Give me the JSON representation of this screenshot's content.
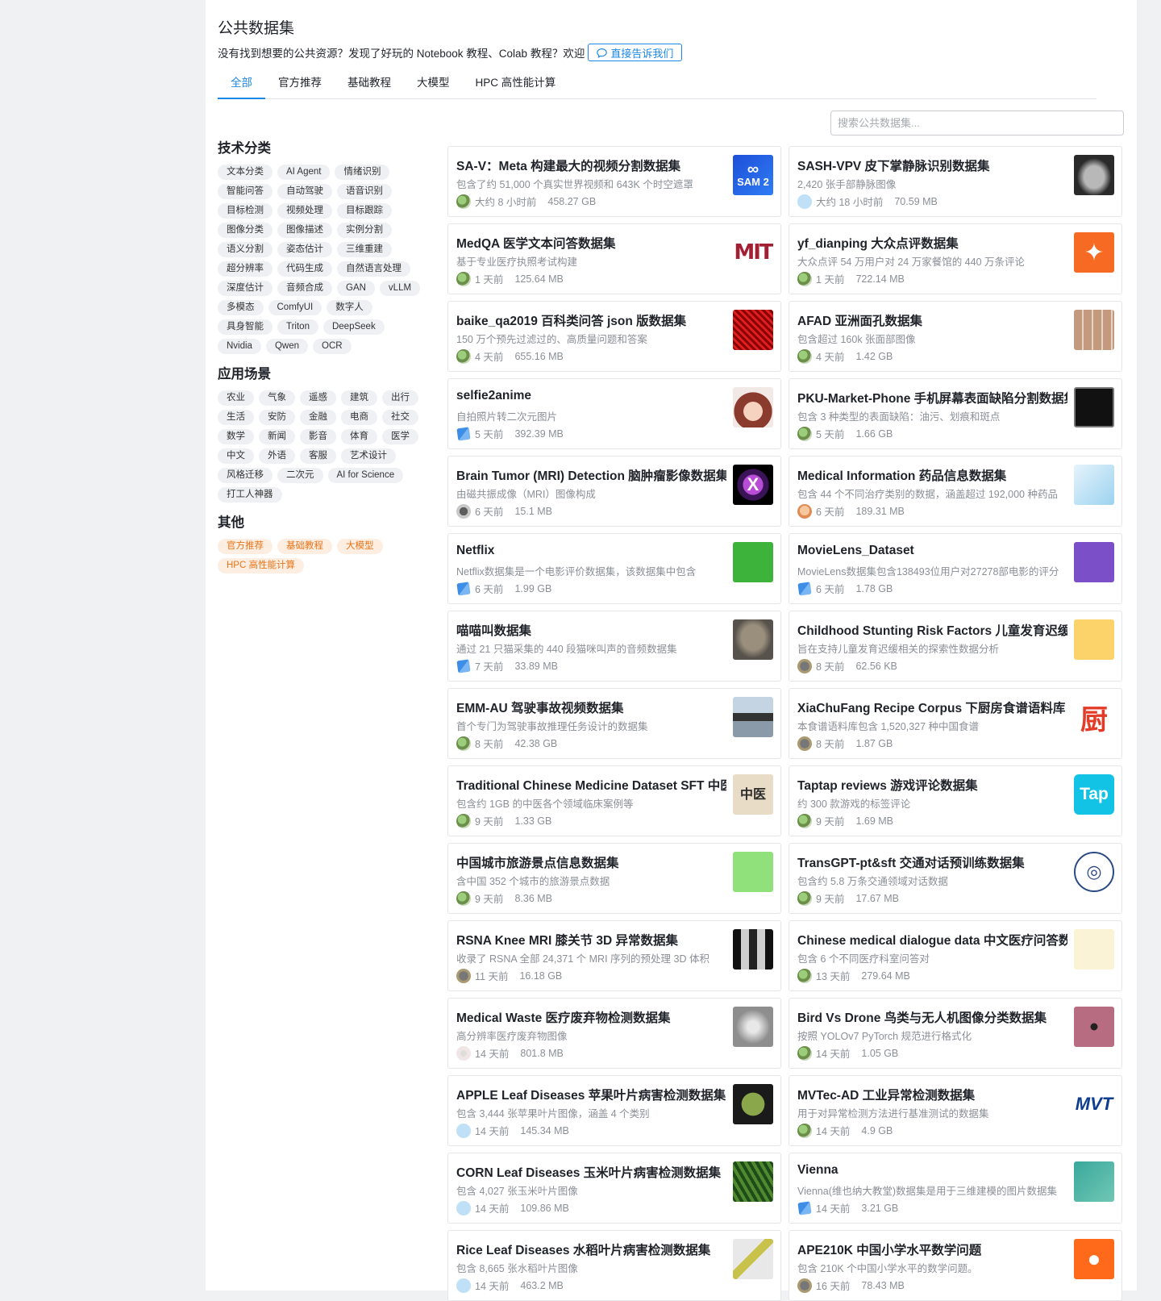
{
  "page": {
    "title": "公共数据集",
    "banner_text": "没有找到想要的公共资源？发现了好玩的 Notebook 教程、Colab 教程？欢迎",
    "contact_button": "直接告诉我们"
  },
  "tabs": [
    {
      "label": "全部",
      "active": true
    },
    {
      "label": "官方推荐",
      "active": false
    },
    {
      "label": "基础教程",
      "active": false
    },
    {
      "label": "大模型",
      "active": false
    },
    {
      "label": "HPC 高性能计算",
      "active": false
    }
  ],
  "search": {
    "placeholder": "搜索公共数据集..."
  },
  "sidebar": {
    "categories": [
      {
        "title": "技术分类",
        "tags": [
          "文本分类",
          "AI Agent",
          "情绪识别",
          "智能问答",
          "自动驾驶",
          "语音识别",
          "目标检测",
          "视频处理",
          "目标跟踪",
          "图像分类",
          "图像描述",
          "实例分割",
          "语义分割",
          "姿态估计",
          "三维重建",
          "超分辨率",
          "代码生成",
          "自然语言处理",
          "深度估计",
          "音频合成",
          "GAN",
          "vLLM",
          "多模态",
          "ComfyUI",
          "数字人",
          "具身智能",
          "Triton",
          "DeepSeek",
          "Nvidia",
          "Qwen",
          "OCR"
        ]
      },
      {
        "title": "应用场景",
        "tags": [
          "农业",
          "气象",
          "遥感",
          "建筑",
          "出行",
          "生活",
          "安防",
          "金融",
          "电商",
          "社交",
          "数学",
          "新闻",
          "影音",
          "体育",
          "医学",
          "中文",
          "外语",
          "客服",
          "艺术设计",
          "风格迁移",
          "二次元",
          "AI for Science",
          "打工人神器"
        ]
      },
      {
        "title": "其他",
        "tags": [
          "官方推荐",
          "基础教程",
          "大模型",
          "HPC 高性能计算"
        ]
      }
    ]
  },
  "datasets": [
    {
      "title": "SA-V：Meta 构建最大的视频分割数据集",
      "desc": "包含了约 51,000 个真实世界视频和 643K 个时空遮罩",
      "updated": "大约 8 小时前",
      "size": "458.27 GB",
      "thumb": "SAM 2"
    },
    {
      "title": "SASH-VPV 皮下掌静脉识别数据集",
      "desc": "2,420 张手部静脉图像",
      "updated": "大约 18 小时前",
      "size": "70.59 MB",
      "thumb": ""
    },
    {
      "title": "MedQA 医学文本问答数据集",
      "desc": "基于专业医疗执照考试构建",
      "updated": "1 天前",
      "size": "125.64 MB",
      "thumb": "MIT"
    },
    {
      "title": "yf_dianping 大众点评数据集",
      "desc": "大众点评 54 万用户对 24 万家餐馆的 440 万条评论",
      "updated": "1 天前",
      "size": "722.14 MB",
      "thumb": "✦"
    },
    {
      "title": "baike_qa2019 百科类问答 json 版数据集",
      "desc": "150 万个预先过滤过的、高质量问题和答案",
      "updated": "4 天前",
      "size": "655.16 MB",
      "thumb": ""
    },
    {
      "title": "AFAD 亚洲面孔数据集",
      "desc": "包含超过 160k 张面部图像",
      "updated": "4 天前",
      "size": "1.42 GB",
      "thumb": ""
    },
    {
      "title": "selfie2anime",
      "desc": "自拍照片转二次元图片",
      "updated": "5 天前",
      "size": "392.39 MB",
      "thumb": ""
    },
    {
      "title": "PKU-Market-Phone 手机屏幕表面缺陷分割数据集",
      "desc": "包含 3 种类型的表面缺陷：油污、划痕和斑点",
      "updated": "5 天前",
      "size": "1.66 GB",
      "thumb": ""
    },
    {
      "title": "Brain Tumor (MRI) Detection 脑肿瘤影像数据集",
      "desc": "由磁共振成像（MRI）图像构成",
      "updated": "6 天前",
      "size": "15.1 MB",
      "thumb": "X"
    },
    {
      "title": "Medical Information 药品信息数据集",
      "desc": "包含 44 个不同治疗类别的数据，涵盖超过 192,000 种药品",
      "updated": "6 天前",
      "size": "189.31 MB",
      "thumb": ""
    },
    {
      "title": "Netflix",
      "desc": "Netflix数据集是一个电影评价数据集，该数据集中包含",
      "updated": "6 天前",
      "size": "1.99 GB",
      "thumb": ""
    },
    {
      "title": "MovieLens_Dataset",
      "desc": "MovieLens数据集包含138493位用户对27278部电影的评分",
      "updated": "6 天前",
      "size": "1.78 GB",
      "thumb": ""
    },
    {
      "title": "喵喵叫数据集",
      "desc": "通过 21 只猫采集的 440 段猫咪叫声的音频数据集",
      "updated": "7 天前",
      "size": "33.89 MB",
      "thumb": ""
    },
    {
      "title": "Childhood Stunting Risk Factors 儿童发育迟缓",
      "desc": "旨在支持儿童发育迟缓相关的探索性数据分析",
      "updated": "8 天前",
      "size": "62.56 KB",
      "thumb": ""
    },
    {
      "title": "EMM-AU 驾驶事故视频数据集",
      "desc": "首个专门为驾驶事故推理任务设计的数据集",
      "updated": "8 天前",
      "size": "42.38 GB",
      "thumb": ""
    },
    {
      "title": "XiaChuFang Recipe Corpus 下厨房食谱语料库",
      "desc": "本食谱语料库包含 1,520,327 种中国食谱",
      "updated": "8 天前",
      "size": "1.87 GB",
      "thumb": "厨"
    },
    {
      "title": "Traditional Chinese Medicine Dataset SFT 中医",
      "desc": "包含约 1GB 的中医各个领域临床案例等",
      "updated": "9 天前",
      "size": "1.33 GB",
      "thumb": "中医"
    },
    {
      "title": "Taptap reviews 游戏评论数据集",
      "desc": "约 300 款游戏的标签评论",
      "updated": "9 天前",
      "size": "1.69 MB",
      "thumb": "Tap"
    },
    {
      "title": "中国城市旅游景点信息数据集",
      "desc": "含中国 352 个城市的旅游景点数据",
      "updated": "9 天前",
      "size": "8.36 MB",
      "thumb": ""
    },
    {
      "title": "TransGPT-pt&sft 交通对话预训练数据集",
      "desc": "包含约 5.8 万条交通领域对话数据",
      "updated": "9 天前",
      "size": "17.67 MB",
      "thumb": "◎"
    },
    {
      "title": "RSNA Knee MRI 膝关节 3D 异常数据集",
      "desc": "收录了 RSNA 全部 24,371 个 MRI 序列的预处理 3D 体积",
      "updated": "11 天前",
      "size": "16.18 GB",
      "thumb": ""
    },
    {
      "title": "Chinese medical dialogue data 中文医疗问答数据集",
      "desc": "包含 6 个不同医疗科室问答对",
      "updated": "13 天前",
      "size": "279.64 MB",
      "thumb": ""
    },
    {
      "title": "Medical Waste 医疗废弃物检测数据集",
      "desc": "高分辨率医疗废弃物图像",
      "updated": "14 天前",
      "size": "801.8 MB",
      "thumb": ""
    },
    {
      "title": "Bird Vs Drone 鸟类与无人机图像分类数据集",
      "desc": "按照 YOLOv7 PyTorch 规范进行格式化",
      "updated": "14 天前",
      "size": "1.05 GB",
      "thumb": ""
    },
    {
      "title": "APPLE Leaf Diseases 苹果叶片病害检测数据集",
      "desc": "包含 3,444 张苹果叶片图像，涵盖 4 个类别",
      "updated": "14 天前",
      "size": "145.34 MB",
      "thumb": ""
    },
    {
      "title": "MVTec-AD 工业异常检测数据集",
      "desc": "用于对异常检测方法进行基准测试的数据集",
      "updated": "14 天前",
      "size": "4.9 GB",
      "thumb": "MVT"
    },
    {
      "title": "CORN Leaf Diseases 玉米叶片病害检测数据集",
      "desc": "包含 4,027 张玉米叶片图像",
      "updated": "14 天前",
      "size": "109.86 MB",
      "thumb": ""
    },
    {
      "title": "Vienna",
      "desc": "Vienna(维也纳大教堂)数据集是用于三维建模的图片数据集",
      "updated": "14 天前",
      "size": "3.21 GB",
      "thumb": ""
    },
    {
      "title": "Rice Leaf Diseases 水稻叶片病害检测数据集",
      "desc": "包含 8,665 张水稻叶片图像",
      "updated": "14 天前",
      "size": "463.2 MB",
      "thumb": ""
    },
    {
      "title": "APE210K 中国小学水平数学问题",
      "desc": "包含 210K 个中国小学水平的数学问题。",
      "updated": "16 天前",
      "size": "78.43 MB",
      "thumb": "●"
    }
  ]
}
